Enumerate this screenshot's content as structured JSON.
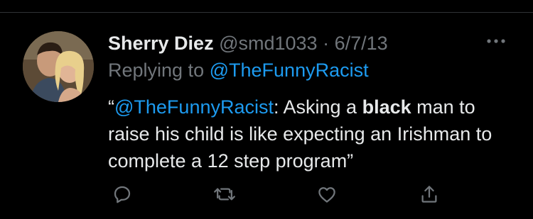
{
  "tweet": {
    "author": {
      "display_name": "Sherry Diez",
      "handle": "@smd1033",
      "separator": "·",
      "date": "6/7/13"
    },
    "replying_to": {
      "prefix": "Replying to",
      "mention": "@TheFunnyRacist"
    },
    "text": {
      "open_quote": "“",
      "mention": "@TheFunnyRacist",
      "part1": ": Asking a ",
      "bold_word": "black",
      "part2": " man to raise his child is like expecting an Irishman to complete a 12 step program”"
    }
  },
  "icons": {
    "more": "more-icon",
    "reply": "reply-icon",
    "retweet": "retweet-icon",
    "like": "like-icon",
    "share": "share-icon"
  },
  "colors": {
    "background": "#000000",
    "text": "#e7e9ea",
    "secondary": "#71767b",
    "link": "#1d9bf0",
    "divider": "#2f3336"
  }
}
